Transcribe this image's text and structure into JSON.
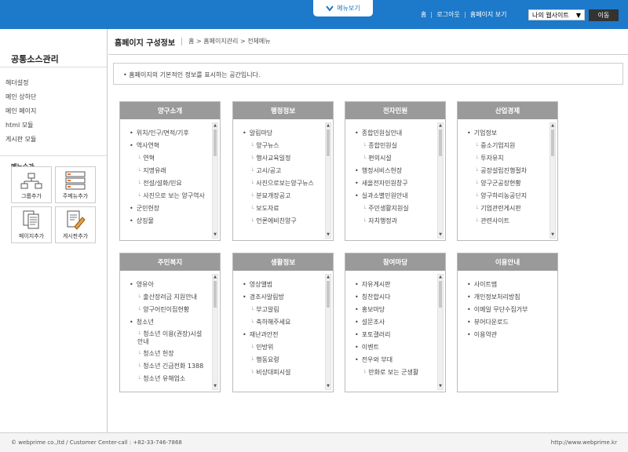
{
  "topbar": {
    "menu_button": "메뉴보기",
    "links": [
      "홈",
      "로그아웃",
      "홈페이지 보기"
    ],
    "site_select": "나의 웹사이트",
    "go_button": "이동"
  },
  "sidebar": {
    "title": "공통소스관리",
    "items": [
      "헤더설정",
      "메인 상하단",
      "메인 페이지",
      "html 모듈",
      "게시판 모듈"
    ],
    "shortcut_title": "메뉴슈가",
    "shortcuts": [
      "그룹추가",
      "주메뉴추가",
      "페이지추가",
      "게시판추가"
    ]
  },
  "main": {
    "title": "홈페이지 구성정보",
    "breadcrumb": "홈 > 홈페이지관리 > 전체메뉴",
    "info": "홈페이지의 기본적인 정보를 표시하는 공간입니다."
  },
  "boxes": [
    {
      "title": "양구소개",
      "items": [
        {
          "level": 1,
          "text": "위치/인구/면적/기후"
        },
        {
          "level": 1,
          "text": "역사연혁"
        },
        {
          "level": 2,
          "text": "연혁"
        },
        {
          "level": 2,
          "text": "지명유래"
        },
        {
          "level": 2,
          "text": "전설/설화/민요"
        },
        {
          "level": 2,
          "text": "사진으로 보는 양구역사"
        },
        {
          "level": 1,
          "text": "군민헌장"
        },
        {
          "level": 1,
          "text": "상징물"
        }
      ]
    },
    {
      "title": "행정정보",
      "items": [
        {
          "level": 1,
          "text": "알림마당"
        },
        {
          "level": 2,
          "text": "양구뉴스"
        },
        {
          "level": 2,
          "text": "행사교육일정"
        },
        {
          "level": 2,
          "text": "고시/공고"
        },
        {
          "level": 2,
          "text": "사진으로보는양구뉴스"
        },
        {
          "level": 2,
          "text": "분묘개장공고"
        },
        {
          "level": 2,
          "text": "보도자료"
        },
        {
          "level": 2,
          "text": "언론에비친양구"
        }
      ]
    },
    {
      "title": "전자민원",
      "items": [
        {
          "level": 1,
          "text": "종합민원실안내"
        },
        {
          "level": 2,
          "text": "종합민원실"
        },
        {
          "level": 2,
          "text": "편의시설"
        },
        {
          "level": 1,
          "text": "행정서비스헌장"
        },
        {
          "level": 1,
          "text": "새올전자민원창구"
        },
        {
          "level": 1,
          "text": "실과소별민원안내"
        },
        {
          "level": 2,
          "text": "주민생활지원실"
        },
        {
          "level": 2,
          "text": "자치행정과"
        }
      ]
    },
    {
      "title": "산업경제",
      "items": [
        {
          "level": 1,
          "text": "기업정보"
        },
        {
          "level": 2,
          "text": "중소기업지원"
        },
        {
          "level": 2,
          "text": "투자유치"
        },
        {
          "level": 2,
          "text": "공장설립진행절차"
        },
        {
          "level": 2,
          "text": "양구군공장현황"
        },
        {
          "level": 2,
          "text": "양구하리농공단지"
        },
        {
          "level": 2,
          "text": "기업관련게시판"
        },
        {
          "level": 2,
          "text": "관련사이트"
        }
      ]
    },
    {
      "title": "주민복지",
      "items": [
        {
          "level": 1,
          "text": "영유아"
        },
        {
          "level": 2,
          "text": "출산장려금 지원안내"
        },
        {
          "level": 2,
          "text": "양구어린이집현황"
        },
        {
          "level": 1,
          "text": "청소년"
        },
        {
          "level": 2,
          "text": "청소년 이용(권장)시설 안내"
        },
        {
          "level": 2,
          "text": "청소년 헌장"
        },
        {
          "level": 2,
          "text": "청소년 긴급전화 1388"
        },
        {
          "level": 2,
          "text": "청소년 유해업소"
        }
      ]
    },
    {
      "title": "생활정보",
      "items": [
        {
          "level": 1,
          "text": "영상앨범"
        },
        {
          "level": 1,
          "text": "경조사알림방"
        },
        {
          "level": 2,
          "text": "부고알림"
        },
        {
          "level": 2,
          "text": "축하해주세요"
        },
        {
          "level": 1,
          "text": "재난과안전"
        },
        {
          "level": 2,
          "text": "민방위"
        },
        {
          "level": 2,
          "text": "행동요령"
        },
        {
          "level": 2,
          "text": "비상대피시설"
        }
      ]
    },
    {
      "title": "참여마당",
      "items": [
        {
          "level": 1,
          "text": "자유게시판"
        },
        {
          "level": 1,
          "text": "칭찬합시다"
        },
        {
          "level": 1,
          "text": "홍보마당"
        },
        {
          "level": 1,
          "text": "설문조사"
        },
        {
          "level": 1,
          "text": "포토갤러리"
        },
        {
          "level": 1,
          "text": "이벤트"
        },
        {
          "level": 1,
          "text": "전우와 부대"
        },
        {
          "level": 2,
          "text": "만화로 보는 군생활"
        }
      ]
    },
    {
      "title": "이용안내",
      "items": [
        {
          "level": 1,
          "text": "사이트맵"
        },
        {
          "level": 1,
          "text": "개인정보처리방침"
        },
        {
          "level": 1,
          "text": "이메일 무단수집거부"
        },
        {
          "level": 1,
          "text": "뷰어다운로드"
        },
        {
          "level": 1,
          "text": "이용약관"
        }
      ]
    }
  ],
  "footer": {
    "left": "© webprime co.,ltd / Customer Center-call : +82-33-746-7868",
    "right": "http://www.webprime.kr"
  }
}
